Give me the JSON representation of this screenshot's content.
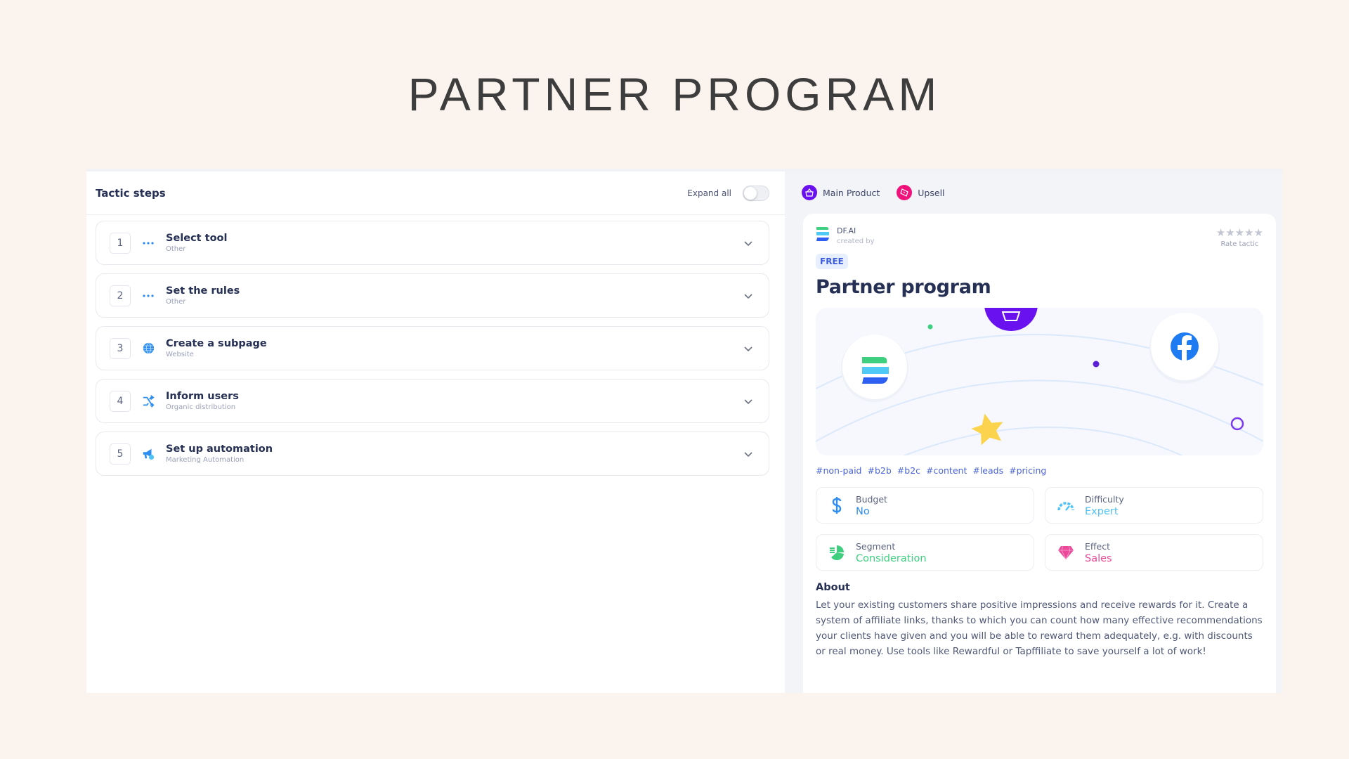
{
  "page": {
    "title": "PARTNER PROGRAM"
  },
  "left": {
    "header": "Tactic steps",
    "expand_all_label": "Expand all",
    "expand_all_on": false,
    "steps": [
      {
        "number": "1",
        "title": "Select tool",
        "category": "Other",
        "icon": "dots-icon"
      },
      {
        "number": "2",
        "title": "Set the rules",
        "category": "Other",
        "icon": "dots-icon"
      },
      {
        "number": "3",
        "title": "Create a subpage",
        "category": "Website",
        "icon": "globe-icon"
      },
      {
        "number": "4",
        "title": "Inform users",
        "category": "Organic distribution",
        "icon": "shuffle-icon"
      },
      {
        "number": "5",
        "title": "Set up automation",
        "category": "Marketing Automation",
        "icon": "megaphone-icon"
      }
    ]
  },
  "right": {
    "badges": [
      {
        "label": "Main Product",
        "icon": "basket-icon",
        "color": "#6a11f0"
      },
      {
        "label": "Upsell",
        "icon": "ticket-icon",
        "color": "#f0127a"
      }
    ],
    "card": {
      "author": "DF.AI",
      "created_by_label": "created by",
      "stars": "★★★★★",
      "rating": 0,
      "rate_label": "Rate tactic",
      "price_badge": "FREE",
      "title": "Partner program",
      "tags": [
        "#non-paid",
        "#b2b",
        "#b2c",
        "#content",
        "#leads",
        "#pricing"
      ],
      "stats": [
        {
          "label": "Budget",
          "value": "No",
          "icon": "dollar-icon",
          "color": "#2d8df0"
        },
        {
          "label": "Difficulty",
          "value": "Expert",
          "icon": "gauge-icon",
          "color": "#4fc3f7"
        },
        {
          "label": "Segment",
          "value": "Consideration",
          "icon": "pie-chart-icon",
          "color": "#3ecf7f"
        },
        {
          "label": "Effect",
          "value": "Sales",
          "icon": "diamond-icon",
          "color": "#ec4899"
        }
      ],
      "about_heading": "About",
      "about_text": "Let your existing customers share positive impressions and receive rewards for it. Create a system of affiliate links, thanks to which you can count how many effective recommendations your clients have given and you will be able to reward them adequately, e.g. with discounts or real money. Use tools like Rewardful or Tapffiliate to save yourself a lot of work!"
    }
  }
}
